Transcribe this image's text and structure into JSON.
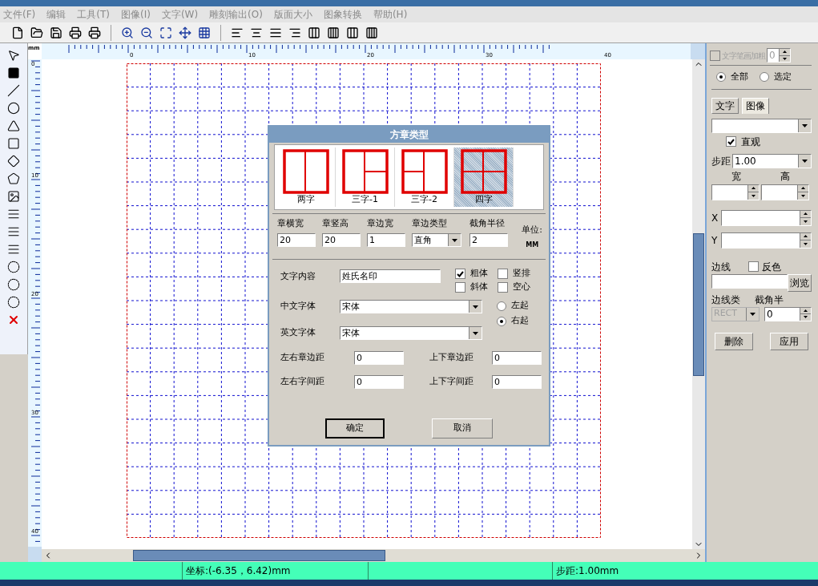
{
  "menu": [
    "文件(F)",
    "编辑",
    "工具(T)",
    "图像(I)",
    "文字(W)",
    "雕刻输出(O)",
    "版面大小",
    "图象转换",
    "帮助(H)"
  ],
  "rulers": {
    "unit": "mm",
    "h_labels": [
      "0",
      "10",
      "20",
      "30",
      "40"
    ],
    "v_labels": [
      "0",
      "10",
      "20",
      "30",
      "40"
    ]
  },
  "dialog": {
    "title": "方章类型",
    "layouts": [
      {
        "kind": "two",
        "label": "两字",
        "selected": false
      },
      {
        "kind": "three1",
        "label": "三字-1",
        "selected": false
      },
      {
        "kind": "three2",
        "label": "三字-2",
        "selected": false
      },
      {
        "kind": "four",
        "label": "四字",
        "selected": true
      }
    ],
    "params": [
      {
        "label": "章横宽",
        "value": "20",
        "kind": "input"
      },
      {
        "label": "章竖高",
        "value": "20",
        "kind": "input"
      },
      {
        "label": "章边宽",
        "value": "1",
        "kind": "input"
      },
      {
        "label": "章边类型",
        "value": "直角",
        "kind": "select"
      },
      {
        "label": "截角半径",
        "value": "2",
        "kind": "input"
      }
    ],
    "unit_label": "单位:",
    "unit_value": "MM",
    "text_label": "文字内容",
    "text_value": "姓氏名印",
    "checks": [
      {
        "label": "粗体",
        "checked": true
      },
      {
        "label": "竖排",
        "checked": false
      },
      {
        "label": "斜体",
        "checked": false
      },
      {
        "label": "空心",
        "checked": false
      }
    ],
    "radios": [
      {
        "label": "左起",
        "selected": false
      },
      {
        "label": "右起",
        "selected": true
      }
    ],
    "fonts": [
      {
        "label": "中文字体",
        "value": "宋体"
      },
      {
        "label": "英文字体",
        "value": "宋体"
      }
    ],
    "spacing": [
      {
        "label": "左右章边距",
        "value": "0"
      },
      {
        "label": "上下章边距",
        "value": "0"
      },
      {
        "label": "左右字间距",
        "value": "0"
      },
      {
        "label": "上下字间距",
        "value": "0"
      }
    ],
    "ok": "确定",
    "cancel": "取消"
  },
  "panel": {
    "bold_check": {
      "label": "文字笔画加粗",
      "checked": false,
      "disabled": true,
      "value": "0"
    },
    "scope": [
      {
        "label": "全部",
        "selected": true
      },
      {
        "label": "选定",
        "selected": false
      }
    ],
    "tabs": [
      {
        "label": "文字",
        "selected": false
      },
      {
        "label": "图像",
        "selected": true
      }
    ],
    "intuitive": {
      "label": "直观",
      "checked": true
    },
    "step_label": "步距",
    "step_value": "1.00",
    "width_label": "宽",
    "height_label": "高",
    "x_label": "X",
    "y_label": "Y",
    "border_width_label": "边线",
    "invert": {
      "label": "反色",
      "checked": false
    },
    "browse": "浏览",
    "border_type_label": "边线类",
    "corner_label": "截角半",
    "border_type_value": "RECT",
    "corner_value": "0",
    "delete": "删除",
    "apply": "应用"
  },
  "status": {
    "coords": "坐标:(-6.35，6.42)mm",
    "step": "步距:1.00mm"
  }
}
